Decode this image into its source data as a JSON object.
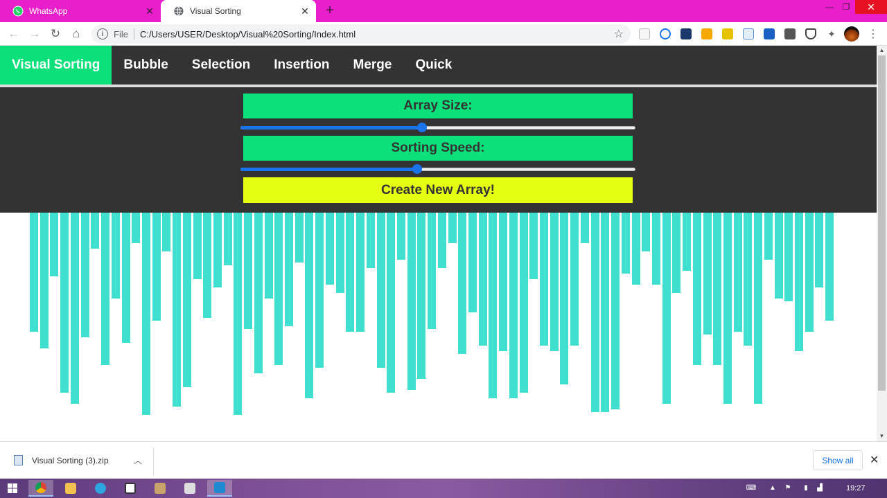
{
  "browser": {
    "tabs": [
      {
        "title": "WhatsApp",
        "active": false,
        "favicon": "whatsapp-icon"
      },
      {
        "title": "Visual Sorting",
        "active": true,
        "favicon": "globe-icon"
      }
    ],
    "address": {
      "scheme_label": "File",
      "url": "C:/Users/USER/Desktop/Visual%20Sorting/Index.html"
    }
  },
  "app": {
    "brand": "Visual Sorting",
    "nav": [
      "Bubble",
      "Selection",
      "Insertion",
      "Merge",
      "Quick"
    ],
    "array_size_label": "Array Size:",
    "array_size_value": 0.46,
    "sorting_speed_label": "Sorting Speed:",
    "sorting_speed_value": 0.448,
    "create_button": "Create New Array!",
    "bar_color": "#40e0d0",
    "accent_color": "#0be07b",
    "button_color": "#e5ff13",
    "array": [
      172,
      196,
      92,
      260,
      276,
      180,
      52,
      220,
      124,
      188,
      44,
      292,
      156,
      56,
      280,
      252,
      96,
      152,
      108,
      76,
      292,
      168,
      232,
      124,
      220,
      164,
      72,
      268,
      224,
      104,
      116,
      172,
      172,
      80,
      224,
      260,
      68,
      256,
      240,
      168,
      80,
      44,
      204,
      144,
      192,
      268,
      200,
      268,
      260,
      96,
      192,
      200,
      248,
      192,
      44,
      288,
      288,
      284,
      88,
      104,
      56,
      104,
      276,
      116,
      84,
      220,
      176,
      220,
      276,
      172,
      192,
      276,
      68,
      124,
      128,
      200,
      172,
      108,
      156
    ]
  },
  "downloads": {
    "file": "Visual Sorting (3).zip",
    "show_all": "Show all"
  },
  "taskbar": {
    "time": "19:27"
  }
}
